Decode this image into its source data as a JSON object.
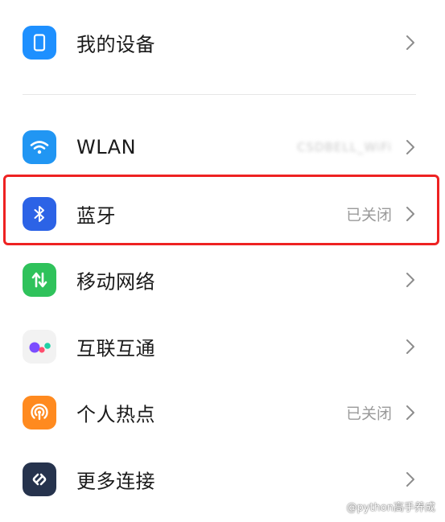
{
  "settings": {
    "my_device": {
      "label": "我的设备",
      "icon": "phone-icon",
      "icon_color": "#1e90ff"
    },
    "wlan": {
      "label": "WLAN",
      "value": "CSDBELL_WiFi",
      "icon": "wifi-icon",
      "icon_color": "#2196f3"
    },
    "bluetooth": {
      "label": "蓝牙",
      "value": "已关闭",
      "icon": "bluetooth-icon",
      "icon_color": "#2c63e6"
    },
    "mobile_network": {
      "label": "移动网络",
      "icon": "mobile-data-icon",
      "icon_color": "#2fc25b"
    },
    "interconnect": {
      "label": "互联互通",
      "icon": "interconnect-icon",
      "icon_color": "#f2f2f2"
    },
    "hotspot": {
      "label": "个人热点",
      "value": "已关闭",
      "icon": "hotspot-icon",
      "icon_color": "#ff8a1f"
    },
    "more_connections": {
      "label": "更多连接",
      "icon": "link-icon",
      "icon_color": "#26334d"
    }
  },
  "highlight_color": "#ee2222",
  "watermark": {
    "text": "@python高手养成"
  }
}
